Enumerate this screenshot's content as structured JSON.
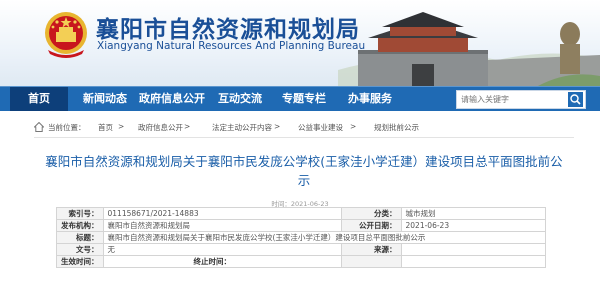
{
  "header": {
    "title": "襄阳市自然资源和规划局",
    "subtitle": "Xiangyang Natural Resources And Planning Bureau"
  },
  "nav": {
    "items": [
      "首页",
      "新闻动态",
      "政府信息公开",
      "互动交流",
      "专题专栏",
      "办事服务"
    ],
    "search_placeholder": "请输入关键字"
  },
  "breadcrumb": {
    "label": "当前位置：",
    "items": [
      "首页",
      "政府信息公开",
      "法定主动公开内容",
      "公益事业建设",
      "规划批前公示"
    ],
    "sep": ">"
  },
  "article": {
    "title": "襄阳市自然资源和规划局关于襄阳市民发庞公学校(王家洼小学迁建）建设项目总平面图批前公示",
    "date": "时间：2021-06-23"
  },
  "info_table": {
    "rows": [
      [
        {
          "label": "索引号：",
          "value": "011158671/2021-14883"
        },
        {
          "label": "分类：",
          "value": "城市规划"
        }
      ],
      [
        {
          "label": "发布机构：",
          "value": "襄阳市自然资源和规划局"
        },
        {
          "label": "公开日期：",
          "value": "2021-06-23"
        }
      ],
      [
        {
          "label": "标题：",
          "value": "襄阳市自然资源和规划局关于襄阳市民发庞公学校(王家洼小学迁建）建设项目总平面图批前公示"
        }
      ],
      [
        {
          "label": "文号：",
          "value": "无"
        },
        {
          "label": "来源：",
          "value": ""
        }
      ],
      [
        {
          "label": "生效时间：",
          "value": ""
        },
        {
          "label": "终止时间：",
          "value": ""
        }
      ]
    ]
  },
  "colors": {
    "nav_bg": "#1f6ab4",
    "nav_active": "#0d3f7a",
    "title_blue": "#1a4f97",
    "link_blue": "#1a5ea8",
    "emblem_red": "#c8161d"
  }
}
